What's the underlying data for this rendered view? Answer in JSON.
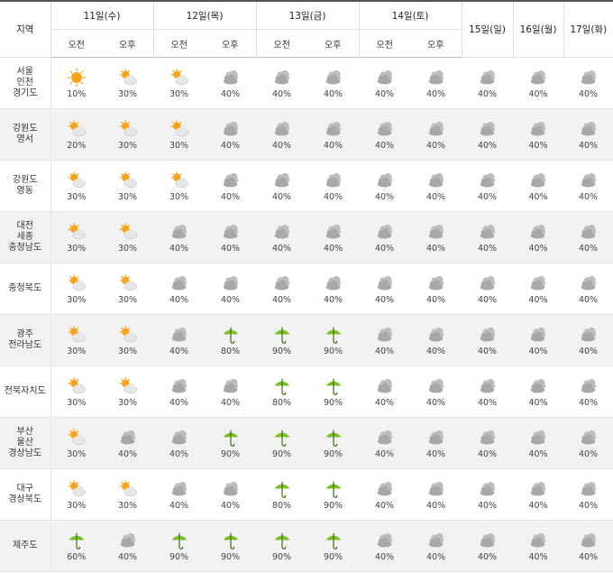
{
  "header": {
    "region_label": "지역",
    "days": [
      {
        "label": "11일(수)",
        "split": true
      },
      {
        "label": "12일(목)",
        "split": true
      },
      {
        "label": "13일(금)",
        "split": true
      },
      {
        "label": "14일(토)",
        "split": true
      },
      {
        "label": "15일(일)",
        "split": false
      },
      {
        "label": "16일(월)",
        "split": false
      },
      {
        "label": "17일(화)",
        "split": false
      }
    ],
    "am_label": "오전",
    "pm_label": "오후"
  },
  "rows": [
    {
      "region": [
        "서울",
        "인천",
        "경기도"
      ],
      "cells": [
        {
          "icon": "sun-icon",
          "pct": "10%"
        },
        {
          "icon": "sun-cloud-icon",
          "pct": "30%"
        },
        {
          "icon": "sun-cloud-icon",
          "pct": "30%"
        },
        {
          "icon": "cloud-icon",
          "pct": "40%"
        },
        {
          "icon": "cloud-icon",
          "pct": "40%"
        },
        {
          "icon": "cloud-icon",
          "pct": "40%"
        },
        {
          "icon": "cloud-icon",
          "pct": "40%"
        },
        {
          "icon": "cloud-icon",
          "pct": "40%"
        },
        {
          "icon": "cloud-icon",
          "pct": "40%"
        },
        {
          "icon": "cloud-icon",
          "pct": "40%"
        },
        {
          "icon": "cloud-icon",
          "pct": "40%"
        }
      ]
    },
    {
      "region": [
        "강원도",
        "영서"
      ],
      "cells": [
        {
          "icon": "sun-cloud-icon",
          "pct": "20%"
        },
        {
          "icon": "sun-cloud-icon",
          "pct": "30%"
        },
        {
          "icon": "sun-cloud-icon",
          "pct": "30%"
        },
        {
          "icon": "cloud-icon",
          "pct": "40%"
        },
        {
          "icon": "cloud-icon",
          "pct": "40%"
        },
        {
          "icon": "cloud-icon",
          "pct": "40%"
        },
        {
          "icon": "cloud-icon",
          "pct": "40%"
        },
        {
          "icon": "cloud-icon",
          "pct": "40%"
        },
        {
          "icon": "cloud-icon",
          "pct": "40%"
        },
        {
          "icon": "cloud-icon",
          "pct": "40%"
        },
        {
          "icon": "cloud-icon",
          "pct": "40%"
        }
      ]
    },
    {
      "region": [
        "강원도",
        "영동"
      ],
      "cells": [
        {
          "icon": "sun-cloud-icon",
          "pct": "30%"
        },
        {
          "icon": "sun-cloud-icon",
          "pct": "30%"
        },
        {
          "icon": "sun-cloud-icon",
          "pct": "30%"
        },
        {
          "icon": "cloud-icon",
          "pct": "40%"
        },
        {
          "icon": "cloud-icon",
          "pct": "40%"
        },
        {
          "icon": "cloud-icon",
          "pct": "40%"
        },
        {
          "icon": "cloud-icon",
          "pct": "40%"
        },
        {
          "icon": "cloud-icon",
          "pct": "40%"
        },
        {
          "icon": "cloud-icon",
          "pct": "40%"
        },
        {
          "icon": "cloud-icon",
          "pct": "40%"
        },
        {
          "icon": "cloud-icon",
          "pct": "40%"
        }
      ]
    },
    {
      "region": [
        "대전",
        "세종",
        "충청남도"
      ],
      "cells": [
        {
          "icon": "sun-cloud-icon",
          "pct": "30%"
        },
        {
          "icon": "sun-cloud-icon",
          "pct": "30%"
        },
        {
          "icon": "cloud-icon",
          "pct": "40%"
        },
        {
          "icon": "cloud-icon",
          "pct": "40%"
        },
        {
          "icon": "cloud-icon",
          "pct": "40%"
        },
        {
          "icon": "cloud-icon",
          "pct": "40%"
        },
        {
          "icon": "cloud-icon",
          "pct": "40%"
        },
        {
          "icon": "cloud-icon",
          "pct": "40%"
        },
        {
          "icon": "cloud-icon",
          "pct": "40%"
        },
        {
          "icon": "cloud-icon",
          "pct": "40%"
        },
        {
          "icon": "cloud-icon",
          "pct": "40%"
        }
      ]
    },
    {
      "region": [
        "충청북도"
      ],
      "cells": [
        {
          "icon": "sun-cloud-icon",
          "pct": "30%"
        },
        {
          "icon": "sun-cloud-icon",
          "pct": "30%"
        },
        {
          "icon": "cloud-icon",
          "pct": "40%"
        },
        {
          "icon": "cloud-icon",
          "pct": "40%"
        },
        {
          "icon": "cloud-icon",
          "pct": "40%"
        },
        {
          "icon": "cloud-icon",
          "pct": "40%"
        },
        {
          "icon": "cloud-icon",
          "pct": "40%"
        },
        {
          "icon": "cloud-icon",
          "pct": "40%"
        },
        {
          "icon": "cloud-icon",
          "pct": "40%"
        },
        {
          "icon": "cloud-icon",
          "pct": "40%"
        },
        {
          "icon": "cloud-icon",
          "pct": "40%"
        }
      ]
    },
    {
      "region": [
        "광주",
        "전라남도"
      ],
      "cells": [
        {
          "icon": "sun-cloud-icon",
          "pct": "30%"
        },
        {
          "icon": "sun-cloud-icon",
          "pct": "30%"
        },
        {
          "icon": "cloud-icon",
          "pct": "40%"
        },
        {
          "icon": "umbrella-icon",
          "pct": "80%"
        },
        {
          "icon": "umbrella-icon",
          "pct": "90%"
        },
        {
          "icon": "umbrella-icon",
          "pct": "90%"
        },
        {
          "icon": "cloud-icon",
          "pct": "40%"
        },
        {
          "icon": "cloud-icon",
          "pct": "40%"
        },
        {
          "icon": "cloud-icon",
          "pct": "40%"
        },
        {
          "icon": "cloud-icon",
          "pct": "40%"
        },
        {
          "icon": "cloud-icon",
          "pct": "40%"
        }
      ]
    },
    {
      "region": [
        "전북자치도"
      ],
      "cells": [
        {
          "icon": "sun-cloud-icon",
          "pct": "30%"
        },
        {
          "icon": "sun-cloud-icon",
          "pct": "30%"
        },
        {
          "icon": "cloud-icon",
          "pct": "40%"
        },
        {
          "icon": "cloud-icon",
          "pct": "40%"
        },
        {
          "icon": "umbrella-icon",
          "pct": "80%"
        },
        {
          "icon": "umbrella-icon",
          "pct": "90%"
        },
        {
          "icon": "cloud-icon",
          "pct": "40%"
        },
        {
          "icon": "cloud-icon",
          "pct": "40%"
        },
        {
          "icon": "cloud-icon",
          "pct": "40%"
        },
        {
          "icon": "cloud-icon",
          "pct": "40%"
        },
        {
          "icon": "cloud-icon",
          "pct": "40%"
        }
      ]
    },
    {
      "region": [
        "부산",
        "울산",
        "경상남도"
      ],
      "cells": [
        {
          "icon": "sun-cloud-icon",
          "pct": "30%"
        },
        {
          "icon": "cloud-icon",
          "pct": "40%"
        },
        {
          "icon": "cloud-icon",
          "pct": "40%"
        },
        {
          "icon": "umbrella-icon",
          "pct": "90%"
        },
        {
          "icon": "umbrella-icon",
          "pct": "90%"
        },
        {
          "icon": "umbrella-icon",
          "pct": "90%"
        },
        {
          "icon": "cloud-icon",
          "pct": "40%"
        },
        {
          "icon": "cloud-icon",
          "pct": "40%"
        },
        {
          "icon": "cloud-icon",
          "pct": "40%"
        },
        {
          "icon": "cloud-icon",
          "pct": "40%"
        },
        {
          "icon": "cloud-icon",
          "pct": "40%"
        }
      ]
    },
    {
      "region": [
        "대구",
        "경상북도"
      ],
      "cells": [
        {
          "icon": "sun-cloud-icon",
          "pct": "30%"
        },
        {
          "icon": "sun-cloud-icon",
          "pct": "30%"
        },
        {
          "icon": "cloud-icon",
          "pct": "40%"
        },
        {
          "icon": "cloud-icon",
          "pct": "40%"
        },
        {
          "icon": "umbrella-icon",
          "pct": "80%"
        },
        {
          "icon": "umbrella-icon",
          "pct": "90%"
        },
        {
          "icon": "cloud-icon",
          "pct": "40%"
        },
        {
          "icon": "cloud-icon",
          "pct": "40%"
        },
        {
          "icon": "cloud-icon",
          "pct": "40%"
        },
        {
          "icon": "cloud-icon",
          "pct": "40%"
        },
        {
          "icon": "cloud-icon",
          "pct": "40%"
        }
      ]
    },
    {
      "region": [
        "제주도"
      ],
      "cells": [
        {
          "icon": "umbrella-icon",
          "pct": "60%"
        },
        {
          "icon": "cloud-icon",
          "pct": "40%"
        },
        {
          "icon": "umbrella-icon",
          "pct": "90%"
        },
        {
          "icon": "umbrella-icon",
          "pct": "90%"
        },
        {
          "icon": "umbrella-icon",
          "pct": "90%"
        },
        {
          "icon": "umbrella-icon",
          "pct": "90%"
        },
        {
          "icon": "cloud-icon",
          "pct": "40%"
        },
        {
          "icon": "cloud-icon",
          "pct": "40%"
        },
        {
          "icon": "cloud-icon",
          "pct": "40%"
        },
        {
          "icon": "cloud-icon",
          "pct": "40%"
        },
        {
          "icon": "cloud-icon",
          "pct": "40%"
        }
      ]
    }
  ],
  "colors": {
    "sun": "#f7a31c",
    "cloud": "#a8a8a8",
    "umbrella": "#7bbf22",
    "row_alt": "#f2f2f2",
    "header_line": "#555555"
  }
}
